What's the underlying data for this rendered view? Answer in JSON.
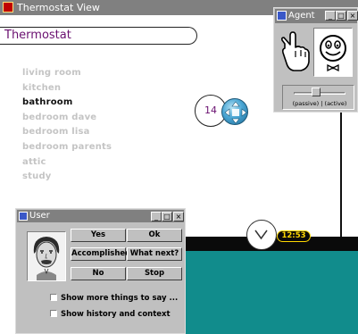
{
  "thermostat_window": {
    "title": "Thermostat View",
    "header": "Thermostat",
    "rooms": [
      {
        "label": "living room",
        "selected": false
      },
      {
        "label": "kitchen",
        "selected": false
      },
      {
        "label": "bathroom",
        "selected": true
      },
      {
        "label": "bedroom dave",
        "selected": false
      },
      {
        "label": "bedroom lisa",
        "selected": false
      },
      {
        "label": "bedroom parents",
        "selected": false
      },
      {
        "label": "attic",
        "selected": false
      },
      {
        "label": "study",
        "selected": false
      }
    ],
    "temperature": "14",
    "clock_time": "12:53"
  },
  "agent_window": {
    "title": "Agent",
    "slider_labels": "(passive) | (active)"
  },
  "user_window": {
    "title": "User",
    "buttons": {
      "yes": "Yes",
      "ok": "Ok",
      "accomplished": "Accomplished",
      "what_next": "What next?",
      "no": "No",
      "stop": "Stop"
    },
    "checkboxes": {
      "more_things": "Show more things to say ...",
      "history": "Show history and context"
    }
  },
  "window_buttons": {
    "minimize": "_",
    "maximize": "□",
    "close": "×"
  },
  "colors": {
    "accent_purple": "#6a1070",
    "teal": "#118c8c",
    "clock_yellow": "#ffd700"
  }
}
